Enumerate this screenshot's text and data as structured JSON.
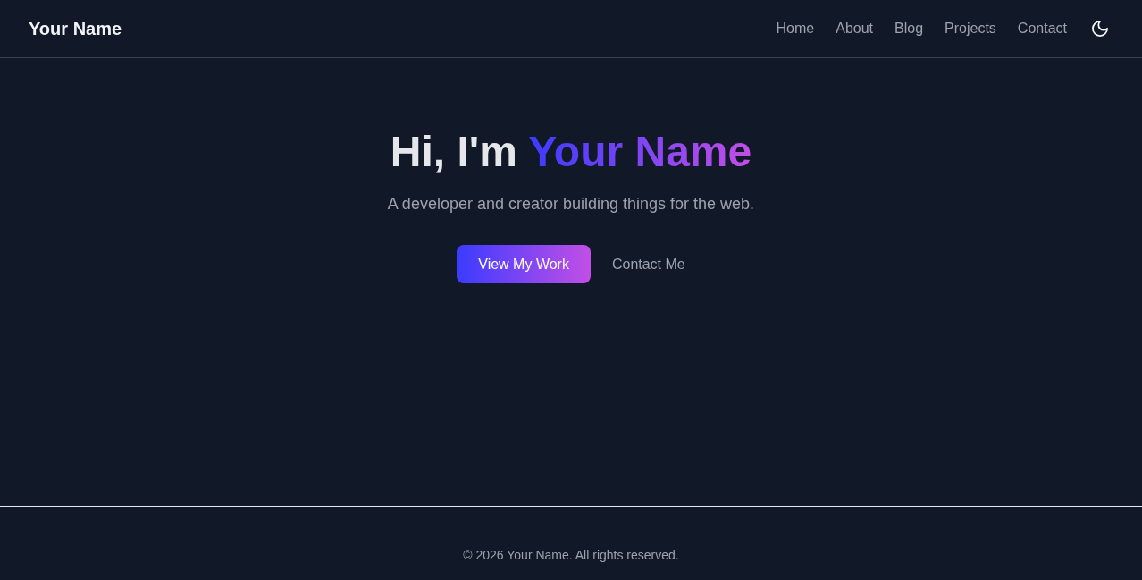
{
  "header": {
    "logo": "Your Name",
    "nav": [
      "Home",
      "About",
      "Blog",
      "Projects",
      "Contact"
    ]
  },
  "hero": {
    "heading": {
      "text": "Hi, I'm",
      "highlight": "Your Name"
    },
    "subtitle": "A developer and creator building things for the web.",
    "buttons": [
      {
        "label": "View My Work",
        "kind": "primary"
      },
      {
        "label": "Contact Me",
        "kind": "secondary"
      }
    ]
  },
  "footer": {
    "copyright": "© 2026 Your Name. All rights reserved."
  }
}
